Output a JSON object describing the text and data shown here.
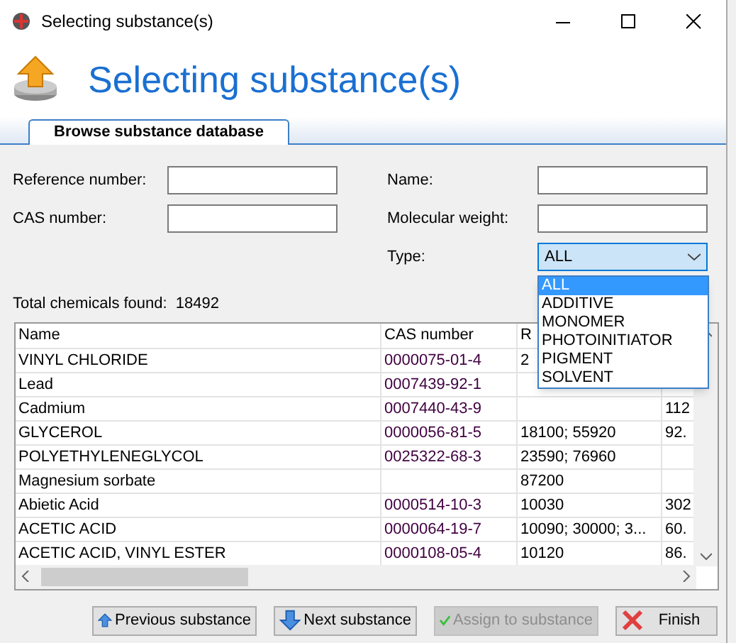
{
  "window": {
    "title": "Selecting substance(s)"
  },
  "header": {
    "title": "Selecting substance(s)"
  },
  "tabs": [
    {
      "label": "Browse substance database",
      "selected": true
    }
  ],
  "form": {
    "reference_number": {
      "label": "Reference number:"
    },
    "cas_number": {
      "label": "CAS number:"
    },
    "name": {
      "label": "Name:"
    },
    "molecular_weight": {
      "label": "Molecular weight:"
    },
    "type": {
      "label": "Type:",
      "value": "ALL",
      "expanded": true,
      "options": [
        {
          "label": "ALL",
          "selected": true
        },
        {
          "label": "ADDITIVE",
          "selected": false
        },
        {
          "label": "MONOMER",
          "selected": false
        },
        {
          "label": "PHOTOINITIATOR",
          "selected": false
        },
        {
          "label": "PIGMENT",
          "selected": false
        },
        {
          "label": "SOLVENT",
          "selected": false
        }
      ]
    }
  },
  "total": {
    "label": "Total chemicals found:",
    "value": "18492"
  },
  "table": {
    "columns": [
      "Name",
      "CAS number",
      "R"
    ],
    "rows": [
      [
        "VINYL CHLORIDE",
        "0000075-01-4",
        "2",
        ""
      ],
      [
        "Lead",
        "0007439-92-1",
        "",
        ""
      ],
      [
        "Cadmium",
        "0007440-43-9",
        "",
        "112"
      ],
      [
        "GLYCEROL",
        "0000056-81-5",
        "18100; 55920",
        "92."
      ],
      [
        "POLYETHYLENEGLYCOL",
        "0025322-68-3",
        "23590; 76960",
        ""
      ],
      [
        "Magnesium sorbate",
        "",
        "87200",
        ""
      ],
      [
        "Abietic Acid",
        "0000514-10-3",
        "10030",
        "302"
      ],
      [
        "ACETIC ACID",
        "0000064-19-7",
        "10090; 30000; 3...",
        "60."
      ],
      [
        "ACETIC ACID, VINYL ESTER",
        "0000108-05-4",
        "10120",
        "86."
      ]
    ]
  },
  "buttons": [
    {
      "kind": "previous",
      "label": "Previous substance",
      "disabled": false
    },
    {
      "kind": "next",
      "label": "Next substance",
      "disabled": false
    },
    {
      "kind": "assign",
      "label": "Assign to substance",
      "disabled": true
    },
    {
      "kind": "finish",
      "label": "Finish",
      "disabled": false
    }
  ]
}
